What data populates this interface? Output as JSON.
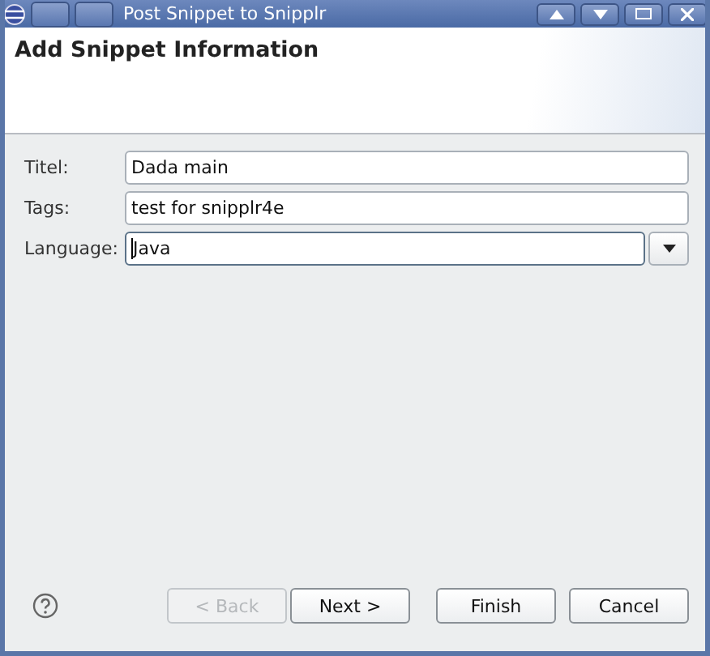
{
  "window": {
    "title": "Post Snippet to Snipplr"
  },
  "header": {
    "title": "Add Snippet Information"
  },
  "fields": [
    {
      "kind": "text",
      "label": "Titel:",
      "value": "Dada main",
      "focused": false
    },
    {
      "kind": "text",
      "label": "Tags:",
      "value": "test for snipplr4e",
      "focused": false
    },
    {
      "kind": "combo",
      "label": "Language:",
      "value": "Java",
      "focused": true
    }
  ],
  "buttons": [
    {
      "label": "< Back",
      "disabled": true
    },
    {
      "label": "Next >",
      "disabled": false
    },
    {
      "label": "Finish",
      "disabled": false
    },
    {
      "label": "Cancel",
      "disabled": false
    }
  ]
}
